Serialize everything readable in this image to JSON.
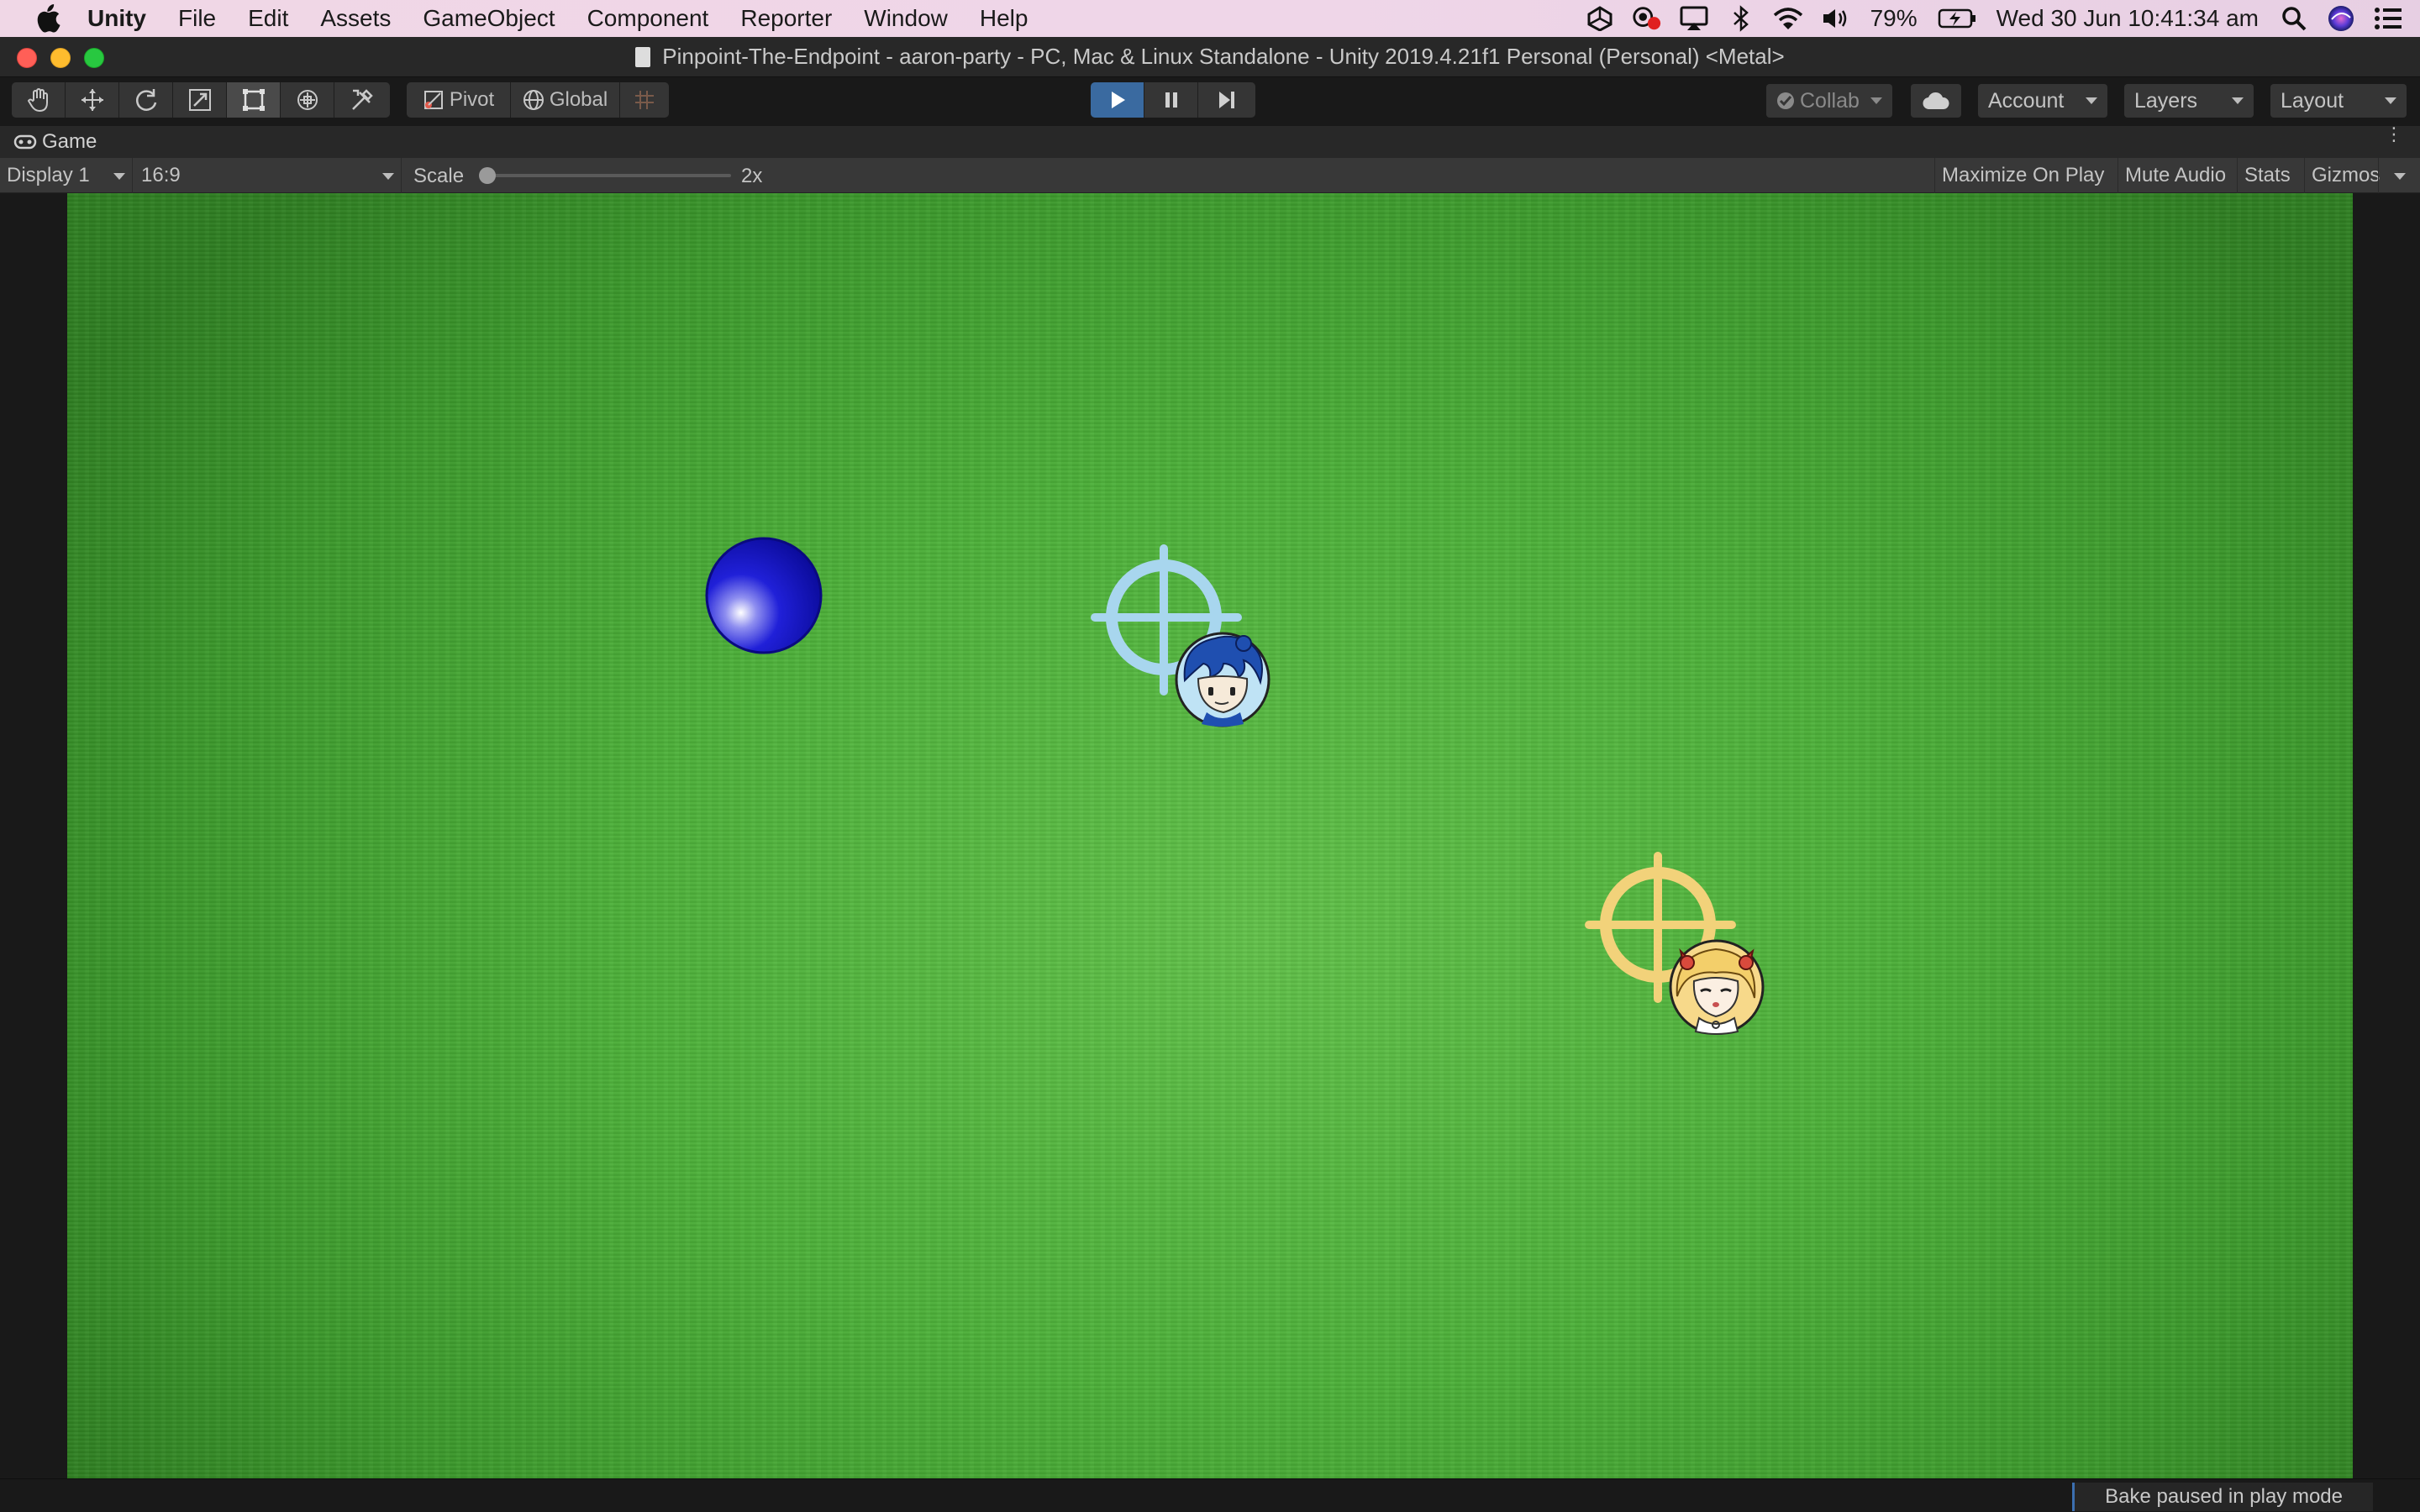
{
  "menubar": {
    "app_name": "Unity",
    "items": [
      "File",
      "Edit",
      "Assets",
      "GameObject",
      "Component",
      "Reporter",
      "Window",
      "Help"
    ],
    "battery": "79%",
    "datetime": "Wed 30 Jun  10:41:34 am"
  },
  "window": {
    "title": "Pinpoint-The-Endpoint - aaron-party - PC, Mac & Linux Standalone - Unity 2019.4.21f1 Personal (Personal) <Metal>"
  },
  "toolbar": {
    "pivot_label": "Pivot",
    "global_label": "Global",
    "collab_label": "Collab",
    "account_label": "Account",
    "layers_label": "Layers",
    "layout_label": "Layout"
  },
  "game_view": {
    "tab_label": "Game",
    "display": "Display 1",
    "aspect": "16:9",
    "scale_label": "Scale",
    "scale_value": "2x",
    "scale_slider_fraction": 0.0,
    "maximize_label": "Maximize On Play",
    "mute_label": "Mute Audio",
    "stats_label": "Stats",
    "gizmos_label": "Gizmos",
    "crosshair_colors": {
      "blue_player": "#a8d6ee",
      "yellow_player": "#f2d27a"
    },
    "ball_color": "#1a1ad0"
  },
  "status": {
    "message": "Bake paused in play mode"
  }
}
